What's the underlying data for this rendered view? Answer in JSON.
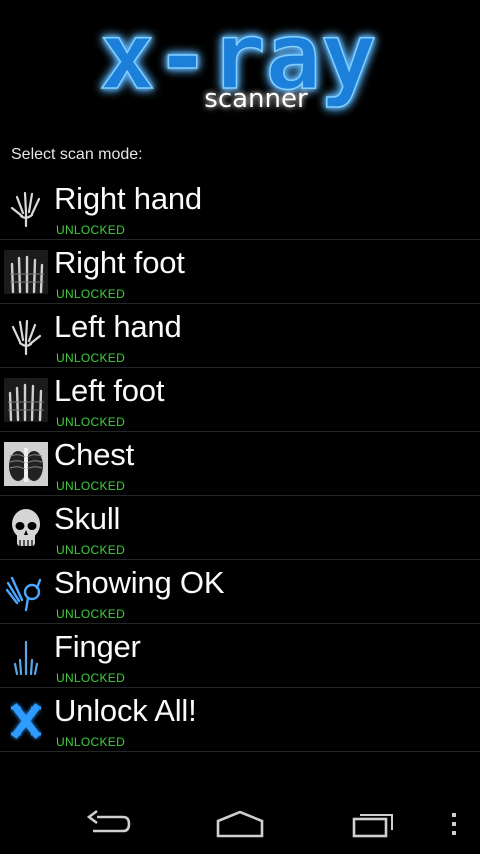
{
  "app": {
    "logo_main": "x-ray",
    "logo_sub": "scanner"
  },
  "section_label": "Select scan mode:",
  "modes": [
    {
      "title": "Right hand",
      "status": "UNLOCKED",
      "icon": "right-hand-xray-icon"
    },
    {
      "title": "Right foot",
      "status": "UNLOCKED",
      "icon": "right-foot-xray-icon"
    },
    {
      "title": "Left hand",
      "status": "UNLOCKED",
      "icon": "left-hand-xray-icon"
    },
    {
      "title": "Left foot",
      "status": "UNLOCKED",
      "icon": "left-foot-xray-icon"
    },
    {
      "title": "Chest",
      "status": "UNLOCKED",
      "icon": "chest-xray-icon"
    },
    {
      "title": "Skull",
      "status": "UNLOCKED",
      "icon": "skull-xray-icon"
    },
    {
      "title": "Showing OK",
      "status": "UNLOCKED",
      "icon": "ok-hand-xray-icon"
    },
    {
      "title": "Finger",
      "status": "UNLOCKED",
      "icon": "finger-xray-icon"
    },
    {
      "title": "Unlock All!",
      "status": "UNLOCKED",
      "icon": "x-logo-icon"
    }
  ],
  "navbar": {
    "buttons": [
      "back-icon",
      "home-icon",
      "recents-icon",
      "overflow-menu-icon"
    ]
  },
  "colors": {
    "background": "#000000",
    "logo_glow": "#2aa8ff",
    "status_green": "#3fcf3f",
    "divider": "#262626"
  }
}
